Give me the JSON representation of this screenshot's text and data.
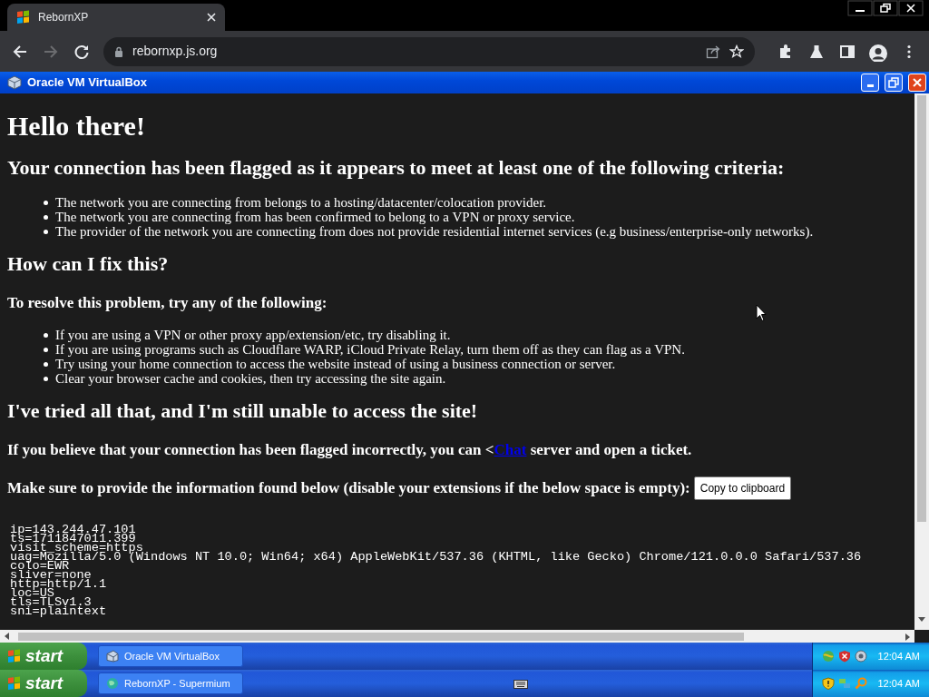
{
  "browser": {
    "tab": {
      "title": "RebornXP",
      "selected": true
    },
    "address": "rebornxp.js.org",
    "forward_disabled": true
  },
  "vm_window": {
    "title": "Oracle VM VirtualBox"
  },
  "page": {
    "blocks": [
      {
        "kind": "h1",
        "text": "Hello there!"
      },
      {
        "kind": "h2",
        "text": "Your connection has been flagged as it appears to meet at least one of the following criteria:"
      },
      {
        "kind": "list",
        "items": [
          "The network you are connecting from belongs to a hosting/datacenter/colocation provider.",
          "The network you are connecting from has been confirmed to belong to a VPN or proxy service.",
          "The provider of the network you are connecting from does not provide residential internet services (e.g business/enterprise-only networks)."
        ]
      },
      {
        "kind": "h2",
        "text": "How can I fix this?"
      },
      {
        "kind": "h3",
        "text": "To resolve this problem, try any of the following:"
      },
      {
        "kind": "list",
        "items": [
          "If you are using a VPN or other proxy app/extension/etc, try disabling it.",
          "If you are using programs such as Cloudflare WARP, iCloud Private Relay, turn them off as they can flag as a VPN.",
          "Try using your home connection to access the website instead of using a business connection or server.",
          "Clear your browser cache and cookies, then try accessing the site again."
        ]
      },
      {
        "kind": "h2",
        "text": "I've tried all that, and I'm still unable to access the site!"
      },
      {
        "kind": "link_para",
        "before": "If you believe that your connection has been flagged incorrectly, you can <",
        "link": "Chat",
        "after": " server and open a ticket."
      },
      {
        "kind": "button_para",
        "text": "Make sure to provide the information found below (disable your extensions if the below space is empty):",
        "button": "Copy to clipboard"
      },
      {
        "kind": "pre",
        "lines": [
          "ip=143.244.47.101",
          "ts=1711847011.399",
          "visit_scheme=https",
          "uag=Mozilla/5.0 (Windows NT 10.0; Win64; x64) AppleWebKit/537.36 (KHTML, like Gecko) Chrome/121.0.0.0 Safari/537.36",
          "colo=EWR",
          "sliver=none",
          "http=http/1.1",
          "loc=US",
          "tls=TLSv1.3",
          "sni=plaintext"
        ]
      }
    ]
  },
  "taskbars": [
    {
      "start": "start",
      "tasks": [
        {
          "label": "Oracle VM VirtualBox",
          "selected": false
        }
      ],
      "clock": "12:04 AM"
    },
    {
      "start": "start",
      "tasks": [
        {
          "label": "RebornXP - Supermium",
          "selected": false
        }
      ],
      "clock": "12:04 AM"
    }
  ]
}
